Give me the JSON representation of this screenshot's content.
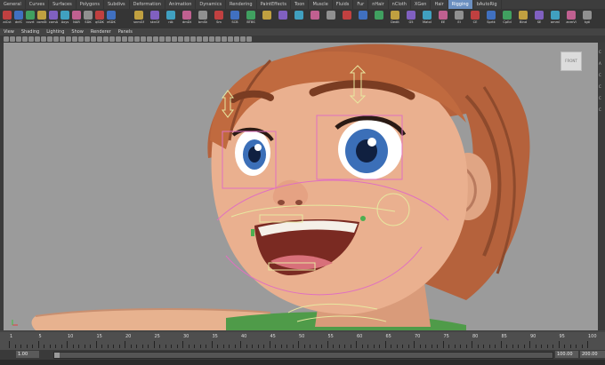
{
  "shelf_tabs": [
    "General",
    "Curves",
    "Surfaces",
    "Polygons",
    "Subdivs",
    "Deformation",
    "Animation",
    "Dynamics",
    "Rendering",
    "PaintEffects",
    "Toon",
    "Muscle",
    "Fluids",
    "Fur",
    "nHair",
    "nCloth",
    "XGen",
    "Hair",
    "Rigging",
    "bAutoRig"
  ],
  "shelf_active_tab": "Rigging",
  "shelf_left": [
    "aiCvt",
    "dnfC",
    "covrt",
    "comSt",
    "comA",
    "Axys",
    "NAR",
    "SDK",
    "qSDK",
    "eSDK"
  ],
  "shelf_right": [
    "snmGf",
    "sknGf",
    "rAt",
    "dmDt",
    "bmSk",
    "Sm",
    "SCB",
    "BTBS",
    "",
    "",
    "",
    "",
    "",
    "",
    "",
    "",
    "Dedit",
    "G5",
    "MatxI",
    "EE",
    "EI",
    "CE",
    "Sprtk",
    "CpEd",
    "Blnd",
    "SE",
    "amml",
    "anmVi",
    "tgtl"
  ],
  "panel_menu": [
    "View",
    "Shading",
    "Lighting",
    "Show",
    "Renderer",
    "Panels"
  ],
  "viewcube_label": "FRONT",
  "side_strip": [
    "C",
    "A",
    "C",
    "C",
    "C",
    "C"
  ],
  "timeline": {
    "labels": [
      "1",
      "5",
      "10",
      "15",
      "20",
      "25",
      "30",
      "35",
      "40",
      "45",
      "50",
      "55",
      "60",
      "65",
      "70",
      "75",
      "80",
      "85",
      "90",
      "95",
      "100"
    ]
  },
  "range": {
    "start_field": "1.00",
    "end_left": "100.00",
    "end_right": "200.00"
  },
  "colors": {
    "viewport_bg": "#9b9b9b",
    "active_tab": "#6b8fc0"
  }
}
